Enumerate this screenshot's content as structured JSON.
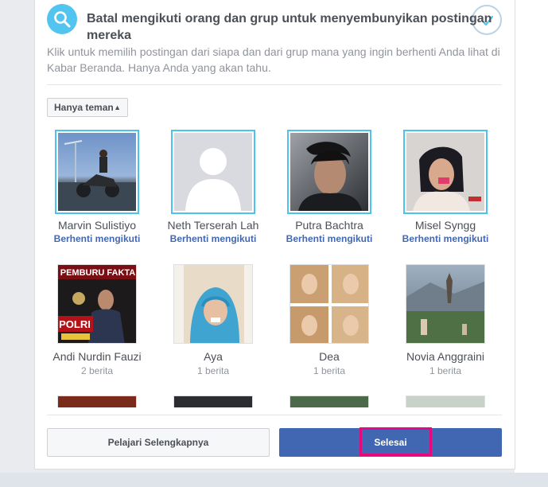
{
  "dialog": {
    "title": "Batal mengikuti orang dan grup untuk menyembunyikan postingan mereka",
    "description": "Klik untuk memilih postingan dari siapa dan dari grup mana yang ingin berhenti Anda lihat di Kabar Beranda. Hanya Anda yang akan tahu.",
    "filter_label": "Hanya teman",
    "learn_more_label": "Pelajari Selengkapnya",
    "done_label": "Selesai"
  },
  "people": [
    {
      "name": "Marvin Sulistiyo",
      "sub": "Berhenti mengikuti",
      "selected": true
    },
    {
      "name": "Neth Terserah Lah",
      "sub": "Berhenti mengikuti",
      "selected": true
    },
    {
      "name": "Putra Bachtra",
      "sub": "Berhenti mengikuti",
      "selected": true
    },
    {
      "name": "Misel Syngg",
      "sub": "Berhenti mengikuti",
      "selected": true
    },
    {
      "name": "Andi Nurdin Fauzi",
      "sub": "2 berita",
      "selected": false
    },
    {
      "name": "Aya",
      "sub": "1 berita",
      "selected": false
    },
    {
      "name": "Dea",
      "sub": "1 berita",
      "selected": false
    },
    {
      "name": "Novia Anggraini",
      "sub": "1 berita",
      "selected": false
    }
  ],
  "photo_texts": {
    "magazine_title": "PEMBURU FAKTA",
    "magazine_headline": "POLRI"
  },
  "colors": {
    "accent": "#4267b2",
    "selected_border": "#4cc3ef",
    "highlight": "#e5097f",
    "icon_bg": "#52c4f0"
  }
}
